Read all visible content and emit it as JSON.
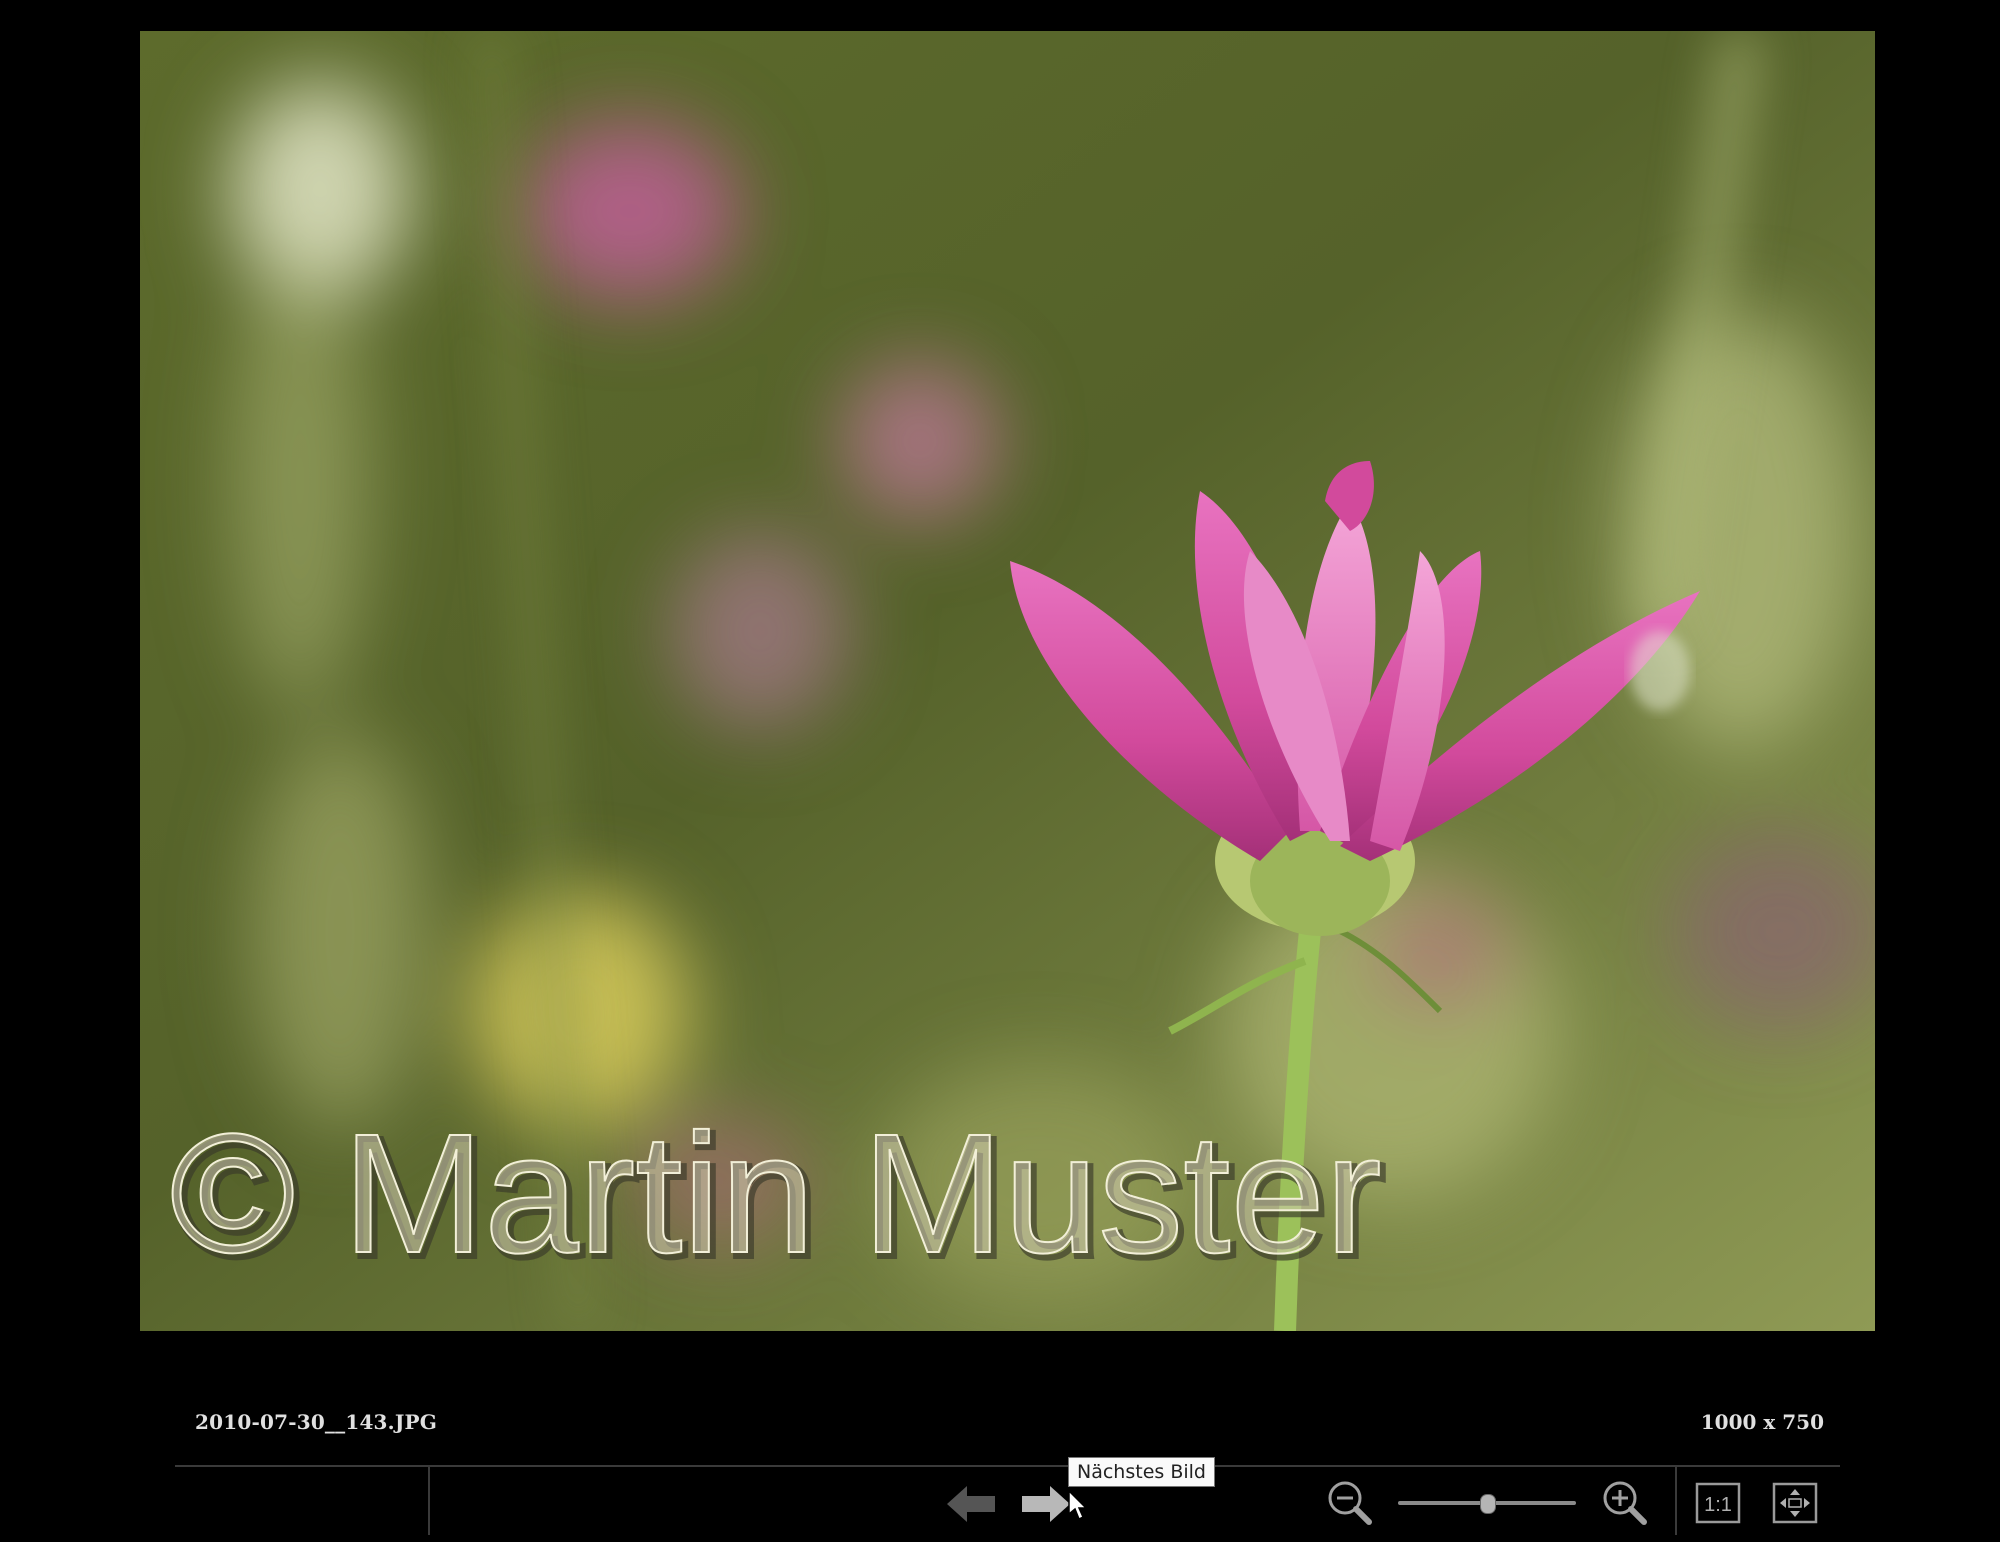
{
  "image": {
    "subject": "pink-cosmos-flower",
    "watermark_text": "© Martin Muster"
  },
  "info": {
    "file_name": "2010-07-30__143.JPG",
    "dimensions": "1000 x 750"
  },
  "toolbar": {
    "prev_icon": "arrow-left-icon",
    "next_icon": "arrow-right-icon",
    "zoom_out_icon": "zoom-out-icon",
    "zoom_in_icon": "zoom-in-icon",
    "zoom_level_fraction": 0.5,
    "one_to_one_label": "1:1",
    "fit_icon": "fit-to-window-icon",
    "tooltip": "Nächstes Bild"
  },
  "colors": {
    "background": "#000000",
    "text": "#e0e0e0",
    "flower": "#d9489a",
    "foliage": "#6b7a35"
  }
}
